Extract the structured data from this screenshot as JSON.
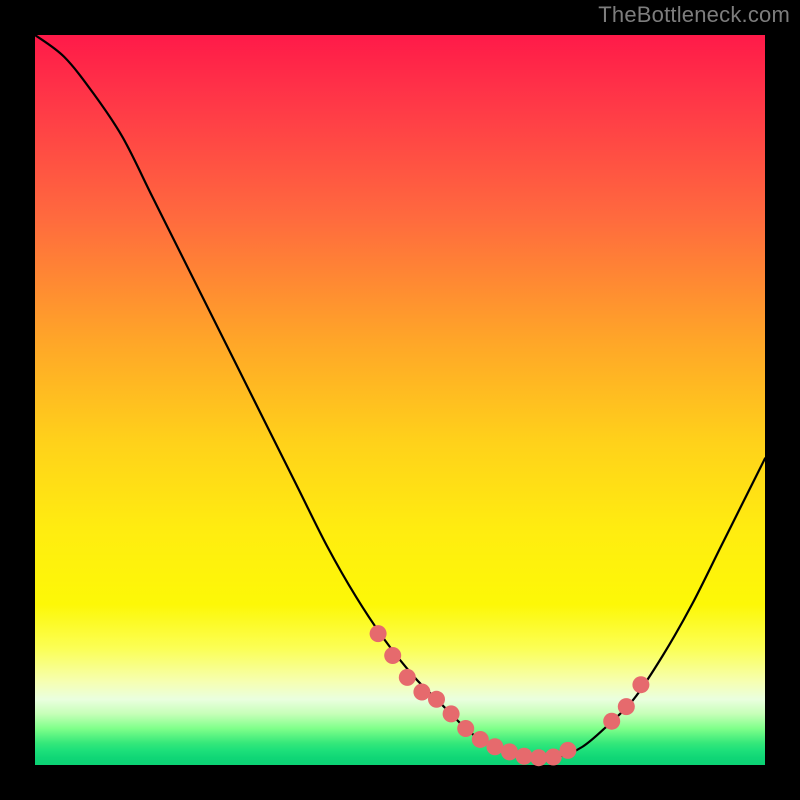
{
  "watermark": "TheBottleneck.com",
  "colors": {
    "marker": "#e66a6d",
    "curve": "#000000",
    "background_top": "#ff1a49",
    "background_bottom": "#0bd274"
  },
  "chart_data": {
    "type": "line",
    "title": "",
    "xlabel": "",
    "ylabel": "",
    "xlim": [
      0,
      100
    ],
    "ylim": [
      0,
      100
    ],
    "series": [
      {
        "name": "bottleneck-curve",
        "x": [
          0,
          4,
          8,
          12,
          16,
          20,
          24,
          28,
          32,
          36,
          40,
          44,
          48,
          52,
          55,
          57,
          59,
          61,
          63,
          65,
          67,
          69,
          72,
          75,
          78,
          82,
          86,
          90,
          94,
          98,
          100
        ],
        "y": [
          100,
          97,
          92,
          86,
          78,
          70,
          62,
          54,
          46,
          38,
          30,
          23,
          17,
          12,
          9,
          7,
          5,
          3.5,
          2.5,
          1.8,
          1.2,
          1.0,
          1.2,
          2.5,
          5,
          9,
          15,
          22,
          30,
          38,
          42
        ]
      }
    ],
    "markers": {
      "name": "highlight-points",
      "x": [
        47,
        49,
        51,
        53,
        55,
        57,
        59,
        61,
        63,
        65,
        67,
        69,
        71,
        73,
        79,
        81,
        83
      ],
      "y": [
        18,
        15,
        12,
        10,
        9,
        7,
        5,
        3.5,
        2.5,
        1.8,
        1.2,
        1.0,
        1.1,
        2.0,
        6,
        8,
        11
      ]
    }
  }
}
